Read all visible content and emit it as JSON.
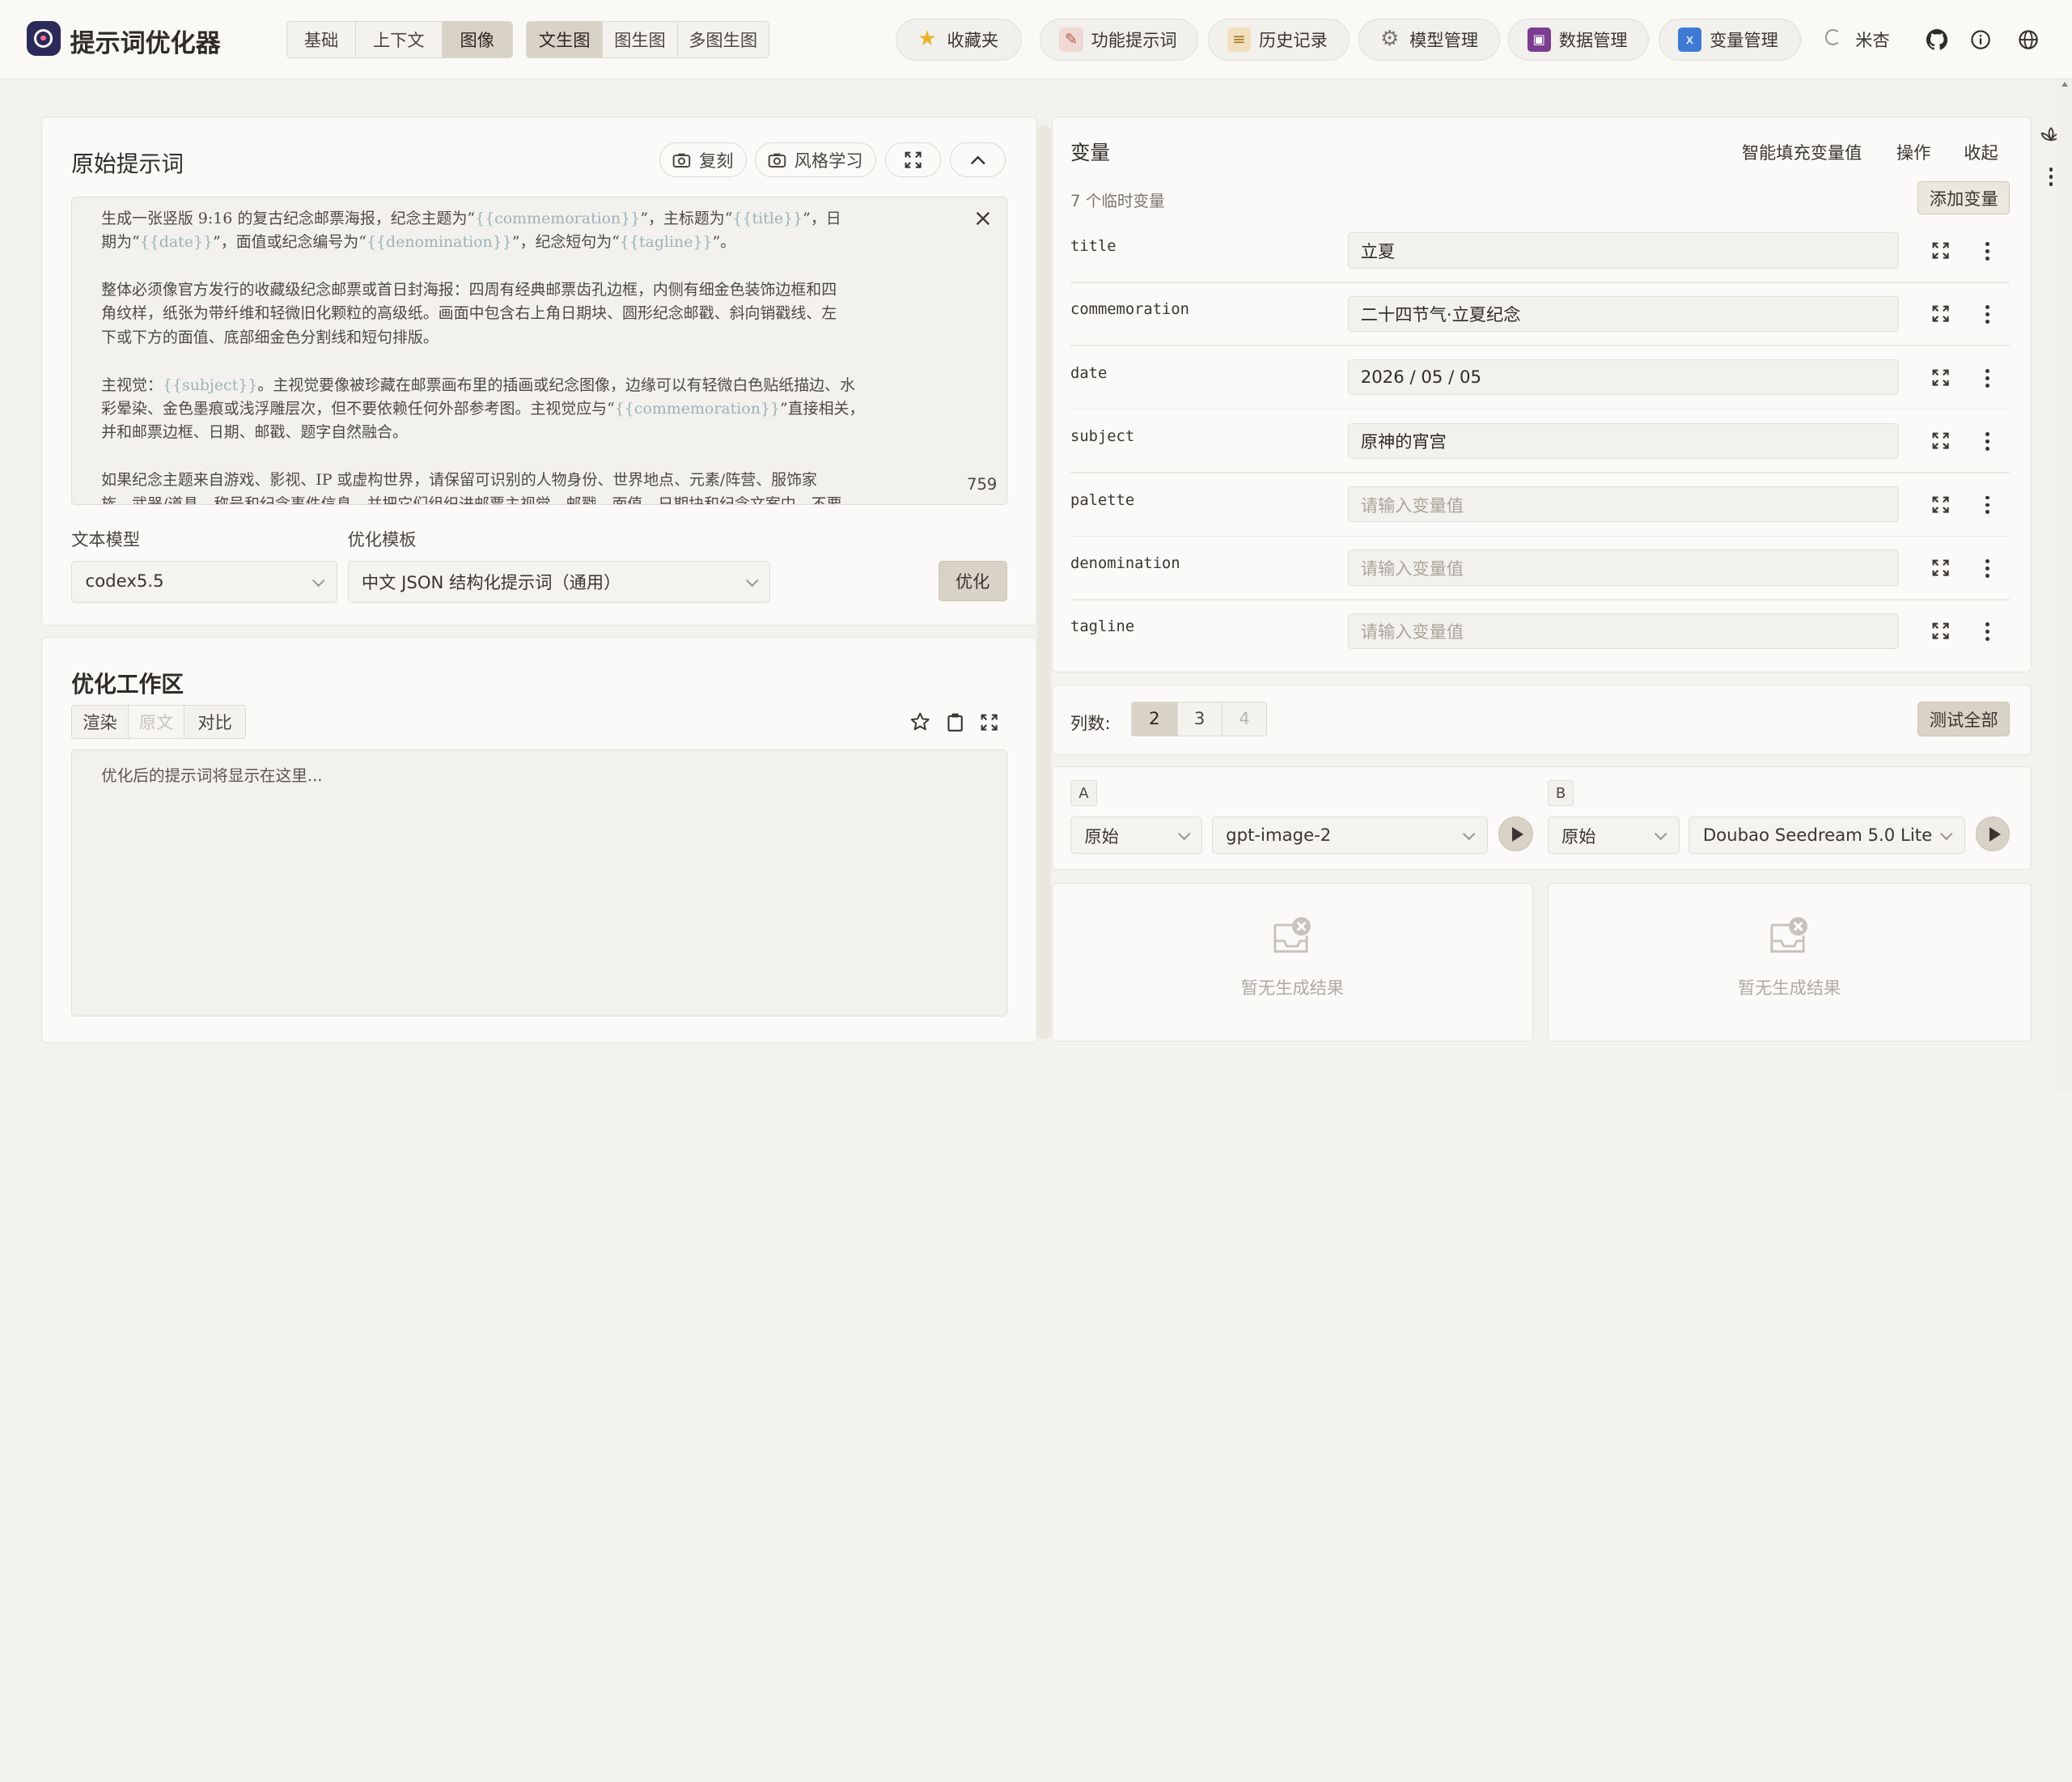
{
  "header": {
    "app_title": "提示词优化器",
    "mode_tabs": [
      "基础",
      "上下文",
      "图像"
    ],
    "mode_active": "图像",
    "image_tabs": [
      "文生图",
      "图生图",
      "多图生图"
    ],
    "image_active": "文生图",
    "buttons": [
      {
        "label": "收藏夹",
        "icon": "star-icon"
      },
      {
        "label": "功能提示词",
        "icon": "document-pen-icon"
      },
      {
        "label": "历史记录",
        "icon": "scroll-icon"
      },
      {
        "label": "模型管理",
        "icon": "gear-icon"
      },
      {
        "label": "数据管理",
        "icon": "floppy-disk-icon"
      },
      {
        "label": "变量管理",
        "icon": "variable-icon"
      }
    ],
    "theme_label": "米杏"
  },
  "original": {
    "title": "原始提示词",
    "copy_label": "复刻",
    "style_label": "风格学习",
    "char_count": "759",
    "paragraphs": [
      [
        [
          "生成一张竖版 9:16 的复古纪念邮票海报，纪念主题为“",
          0
        ],
        [
          "{{commemoration}}",
          1
        ],
        [
          "”，主标题为“",
          0
        ],
        [
          "{{title}}",
          1
        ],
        [
          "”，日",
          0
        ]
      ],
      [
        [
          "期为“",
          0
        ],
        [
          "{{date}}",
          1
        ],
        [
          "”，面值或纪念编号为“",
          0
        ],
        [
          "{{denomination}}",
          1
        ],
        [
          "”，纪念短句为“",
          0
        ],
        [
          "{{tagline}}",
          1
        ],
        [
          "”。",
          0
        ]
      ],
      [
        [
          "整体必须像官方发行的收藏级纪念邮票或首日封海报：四周有经典邮票齿孔边框，内侧有细金色装饰边框和四",
          0
        ]
      ],
      [
        [
          "角纹样，纸张为带纤维和轻微旧化颗粒的高级纸。画面中包含右上角日期块、圆形纪念邮戳、斜向销戳线、左",
          0
        ]
      ],
      [
        [
          "下或下方的面值、底部细金色分割线和短句排版。",
          0
        ]
      ],
      [
        [
          "主视觉：",
          0
        ],
        [
          "{{subject}}",
          1
        ],
        [
          "。主视觉要像被珍藏在邮票画布里的插画或纪念图像，边缘可以有轻微白色贴纸描边、水",
          0
        ]
      ],
      [
        [
          "彩晕染、金色墨痕或浅浮雕层次，但不要依赖任何外部参考图。主视觉应与“",
          0
        ],
        [
          "{{commemoration}}",
          1
        ],
        [
          "”直接相关，",
          0
        ]
      ],
      [
        [
          "并和邮票边框、日期、邮戳、题字自然融合。",
          0
        ]
      ],
      [
        [
          "如果纪念主题来自游戏、影视、IP 或虚构世界，请保留可识别的人物身份、世界地点、元素/阵营、服饰家",
          0
        ]
      ],
      [
        [
          "族、武器/道具、称号和纪念事件信息，并把它们组织进邮票主视觉、邮戳、面值、日期块和纪念文案中，不要",
          0
        ]
      ]
    ],
    "text_model_label": "文本模型",
    "text_model_value": "codex5.5",
    "template_label": "优化模板",
    "template_value": "中文 JSON 结构化提示词（通用）",
    "optimize_label": "优化"
  },
  "workspace": {
    "title": "优化工作区",
    "tabs": [
      "渲染",
      "原文",
      "对比"
    ],
    "placeholder": "优化后的提示词将显示在这里..."
  },
  "variables": {
    "title": "变量",
    "smart_fill": "智能填充变量值",
    "ops": "操作",
    "collapse": "收起",
    "count_text": "7 个临时变量",
    "add_label": "添加变量",
    "placeholder": "请输入变量值",
    "items": [
      {
        "name": "title",
        "value": "立夏"
      },
      {
        "name": "commemoration",
        "value": "二十四节气·立夏纪念"
      },
      {
        "name": "date",
        "value": "2026 / 05 / 05"
      },
      {
        "name": "subject",
        "value": "原神的宵宫"
      },
      {
        "name": "palette",
        "value": ""
      },
      {
        "name": "denomination",
        "value": ""
      },
      {
        "name": "tagline",
        "value": ""
      }
    ]
  },
  "test": {
    "columns_label": "列数:",
    "columns": [
      "2",
      "3",
      "4"
    ],
    "columns_active": "2",
    "test_all": "测试全部",
    "slots": [
      {
        "tag": "A",
        "mode": "原始",
        "model": "gpt-image-2",
        "empty": "暂无生成结果"
      },
      {
        "tag": "B",
        "mode": "原始",
        "model": "Doubao Seedream 5.0 Lite",
        "empty": "暂无生成结果"
      }
    ]
  },
  "colors": {
    "accent": "#d9d2c6",
    "background": "#f3f2ee",
    "variable_token": "#9ab3ba"
  }
}
